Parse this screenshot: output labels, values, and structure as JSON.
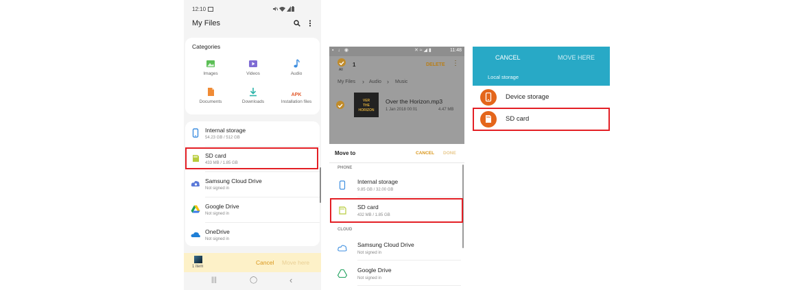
{
  "panel_a": {
    "status_time": "12:10",
    "title": "My Files",
    "categories_title": "Categories",
    "categories": [
      {
        "label": "Images",
        "icon": "image-icon",
        "color": "#5cbf56"
      },
      {
        "label": "Videos",
        "icon": "video-icon",
        "color": "#7f6cd4"
      },
      {
        "label": "Audio",
        "icon": "music-note-icon",
        "color": "#3d8ee0"
      },
      {
        "label": "Documents",
        "icon": "document-icon",
        "color": "#f08b35"
      },
      {
        "label": "Downloads",
        "icon": "download-icon",
        "color": "#2bb3a8"
      },
      {
        "label": "Installation files",
        "icon": "apk-icon",
        "color": "#e25a2c"
      }
    ],
    "apk_glyph": "APK",
    "storage": [
      {
        "name": "Internal storage",
        "sub": "54.23 GB / 512 GB",
        "icon": "phone-icon"
      },
      {
        "name": "SD card",
        "sub": "433 MB / 1.85 GB",
        "icon": "sd-card-icon"
      },
      {
        "name": "Samsung Cloud Drive",
        "sub": "Not signed in",
        "icon": "samsung-cloud-icon"
      },
      {
        "name": "Google Drive",
        "sub": "Not signed in",
        "icon": "google-drive-icon"
      },
      {
        "name": "OneDrive",
        "sub": "Not signed in",
        "icon": "onedrive-icon"
      }
    ],
    "bottom": {
      "count": "1 item",
      "cancel": "Cancel",
      "move_here": "Move here"
    },
    "nav": {
      "recents": "|||",
      "home": "◯",
      "back": "‹"
    },
    "accent": "#d9961a",
    "highlight": "#e31e24"
  },
  "panel_b": {
    "status_time": "11:48",
    "selected_count": "1",
    "all_label": "All",
    "delete_label": "DELETE",
    "breadcrumb": [
      "My Files",
      "Audio",
      "Music"
    ],
    "file": {
      "name": "Over the Horizon.mp3",
      "date": "1 Jan 2018 00:01",
      "size": "4.47 MB",
      "art": [
        "VER",
        "THE",
        "HORIZON"
      ]
    },
    "move_to": "Move to",
    "cancel": "CANCEL",
    "done": "DONE",
    "sections": {
      "phone": "PHONE",
      "cloud": "CLOUD"
    },
    "phone_items": [
      {
        "name": "Internal storage",
        "sub": "9.85 GB / 32.00 GB",
        "icon": "phone-icon"
      },
      {
        "name": "SD card",
        "sub": "432 MB / 1.85 GB",
        "icon": "sd-card-icon"
      }
    ],
    "cloud_items": [
      {
        "name": "Samsung Cloud Drive",
        "sub": "Not signed in",
        "icon": "samsung-cloud-icon"
      },
      {
        "name": "Google Drive",
        "sub": "Not signed in",
        "icon": "google-drive-icon"
      }
    ]
  },
  "panel_c": {
    "cancel": "CANCEL",
    "move_here": "MOVE HERE",
    "local_storage": "Local storage",
    "items": [
      {
        "name": "Device storage",
        "icon": "phone-icon"
      },
      {
        "name": "SD card",
        "icon": "sd-card-icon"
      }
    ],
    "header_color": "#28a9c6",
    "icon_color": "#e4661b"
  }
}
